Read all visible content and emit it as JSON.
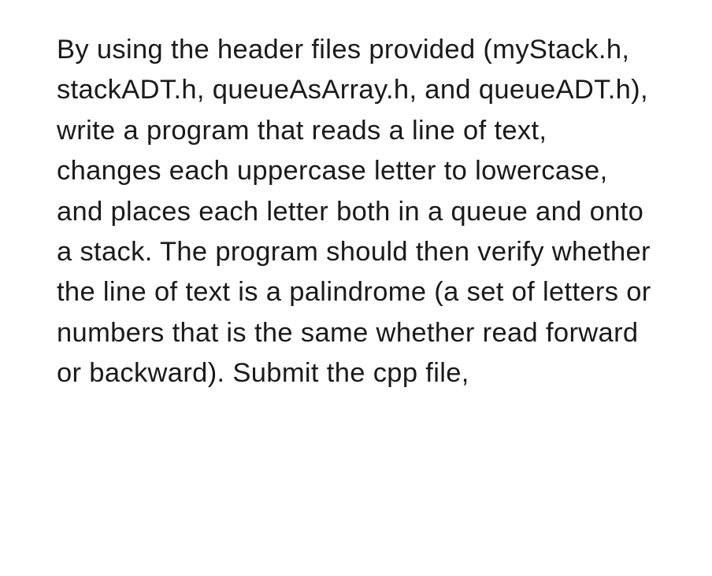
{
  "document": {
    "body_text": "By using the header files provided (myStack.h, stackADT.h, queueAsArray.h, and queueADT.h), write a program that reads a line of text, changes each uppercase letter to lowercase, and places each letter both in a queue and onto a stack. The program should then verify whether the line of text is a palindrome (a set of letters or numbers that is the same whether read forward or backward). Submit the cpp file,"
  }
}
